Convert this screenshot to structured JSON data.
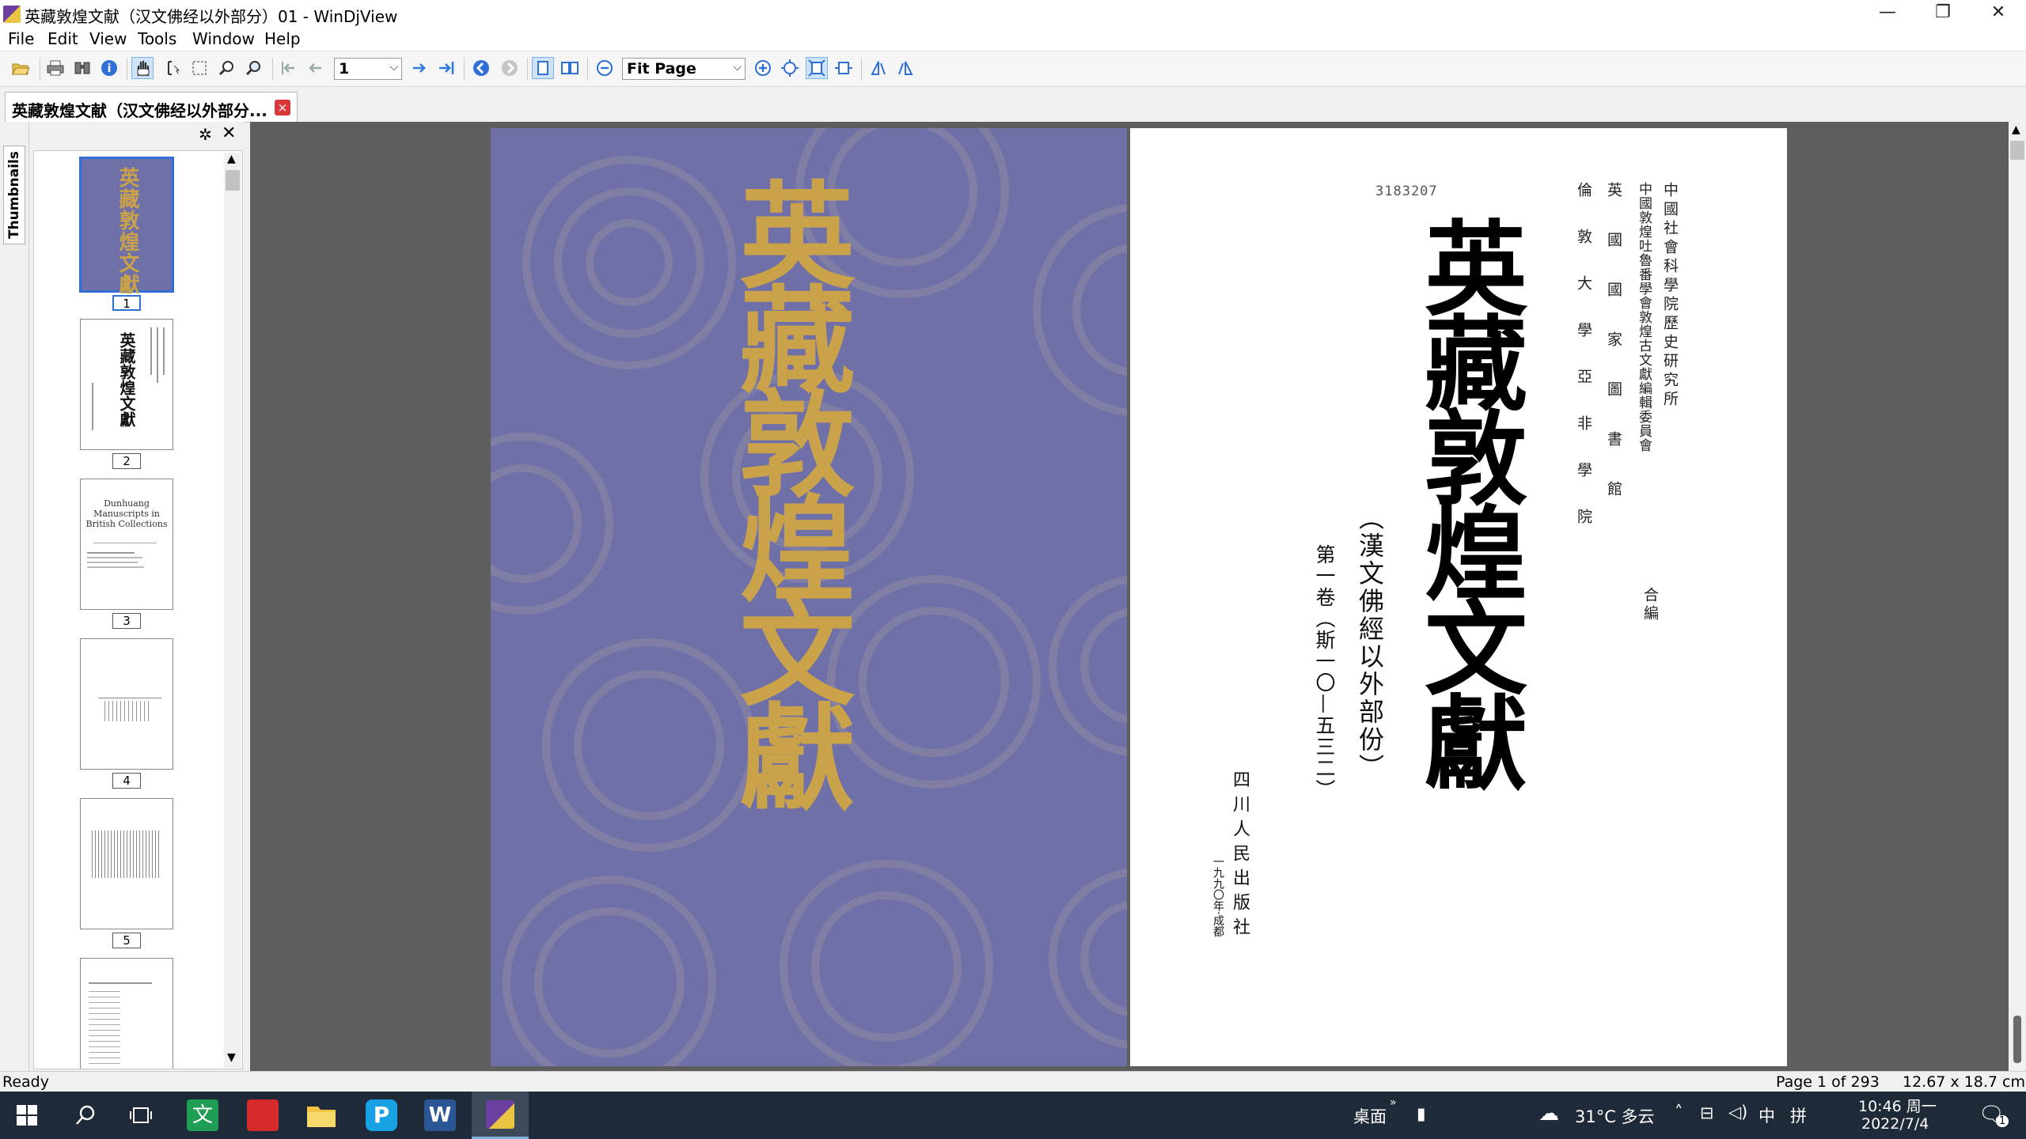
{
  "window": {
    "title": "英藏敦煌文献（汉文佛经以外部分）01 - WinDjView",
    "minimize": "—",
    "restore": "❐",
    "close": "✕"
  },
  "menu": [
    "File",
    "Edit",
    "View",
    "Tools",
    "Window",
    "Help"
  ],
  "toolbar": {
    "page_value": "1",
    "zoom_value": "Fit Page"
  },
  "tab": {
    "label": "英藏敦煌文献（汉文佛经以外部分...",
    "close": "×"
  },
  "sidebar": {
    "tab_label": "Thumbnails",
    "thumbnails": [
      {
        "num": "1",
        "selected": true
      },
      {
        "num": "2",
        "selected": false
      },
      {
        "num": "3",
        "selected": false
      },
      {
        "num": "4",
        "selected": false
      },
      {
        "num": "5",
        "selected": false
      }
    ],
    "thumb3_text": "Dunhuang Manuscripts in British Collections",
    "thumb1_text": "英藏敦煌文獻",
    "thumb2_text": "英藏敦煌文獻"
  },
  "cover": {
    "title": "英藏敦煌文獻",
    "background": "#6f70a8",
    "title_color": "#c9a24a"
  },
  "title_page": {
    "serial": "3183207",
    "org_line1": "中國社會科學院歷史研究所",
    "org_line2": "中國敦煌吐魯番學會敦煌古文獻編輯委員會",
    "org_line3": "英國國家圖書館",
    "org_line4": "倫敦大學亞非學院",
    "org_suffix": "合編",
    "main_title": "英藏敦煌文獻",
    "subtitle": "（漢文佛經以外部份）",
    "volume": "第一卷（斯一〇—五三二）",
    "publisher": "四川人民出版社",
    "pub_date": "一九九〇年·成都"
  },
  "status": {
    "left": "Ready",
    "page": "Page 1 of 293",
    "size": "12.67 x 18.7 cm"
  },
  "taskbar": {
    "desktop_label": "桌面",
    "weather": "31°C 多云",
    "ime": "中",
    "ime2": "拼",
    "time": "10:46 周一",
    "date": "2022/7/4",
    "notif_count": "1",
    "app_label_zh": "文"
  }
}
